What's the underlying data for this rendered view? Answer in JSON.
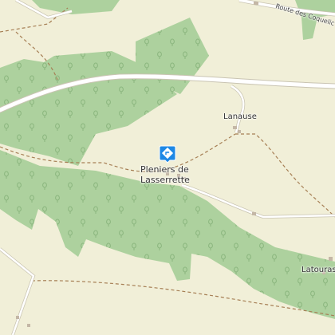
{
  "map": {
    "labels": {
      "lanause": "Lanause",
      "pleniers_line1": "Pleniers de",
      "pleniers_line2": "Lasserrette",
      "latourasse": "Latourass",
      "road_coquelicots": "Route des Coquelic"
    },
    "icons": {
      "marker": "directions-marker-icon",
      "trees": "tree-icon"
    },
    "colors": {
      "background": "#f1efd8",
      "forest": "#add19e",
      "tree_glyph": "#8ab57d",
      "road_fill": "#ffffff",
      "road_casing": "#c9c4b2",
      "track": "#a67f55",
      "marker": "#1e88e5"
    }
  }
}
